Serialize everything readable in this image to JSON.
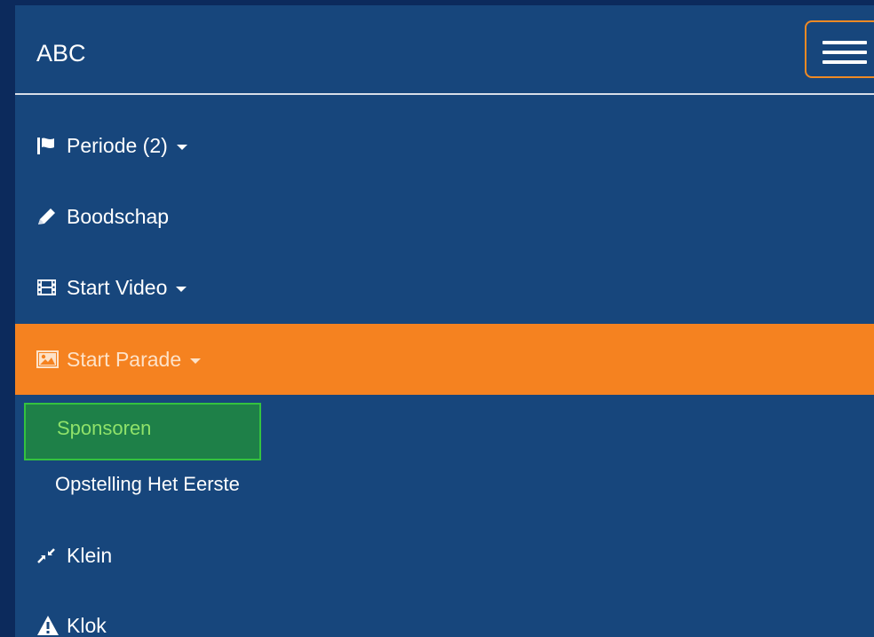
{
  "navbar": {
    "brand": "ABC",
    "toggle_icon": "hamburger-icon"
  },
  "menu": {
    "items": [
      {
        "label": "Periode (2)",
        "icon": "flag-icon",
        "dropdown": true
      },
      {
        "label": "Boodschap",
        "icon": "pencil-icon",
        "dropdown": false
      },
      {
        "label": "Start Video",
        "icon": "film-icon",
        "dropdown": true
      },
      {
        "label": "Start Parade",
        "icon": "picture-icon",
        "dropdown": true,
        "active": true
      },
      {
        "label": "Klein",
        "icon": "compress-icon",
        "dropdown": false
      },
      {
        "label": "Klok",
        "icon": "warning-icon",
        "dropdown": false
      }
    ],
    "submenu": [
      {
        "label": "Sponsoren",
        "selected": true
      },
      {
        "label": "Opstelling Het Eerste"
      }
    ]
  },
  "colors": {
    "background": "#17467c",
    "active": "#f58220",
    "selected": "#1e8048",
    "selected_border": "#34c23f",
    "toggle_border": "#f08a24"
  }
}
